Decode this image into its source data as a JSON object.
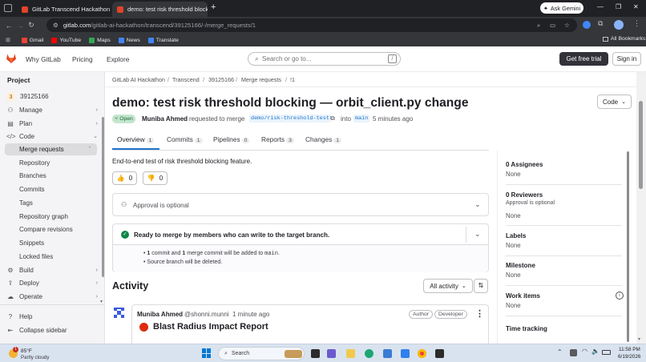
{
  "browser": {
    "tabs": [
      {
        "title": "GitLab Transcend Hackathon o"
      },
      {
        "title": "demo: test risk threshold blocki"
      }
    ],
    "ask_gemini": "Ask Gemini",
    "url_host": "gitlab.com",
    "url_path": "/gitlab-ai-hackathon/transcend/39125166/-/merge_requests/1",
    "bookmarks": [
      "Gmail",
      "YouTube",
      "Maps",
      "News",
      "Translate"
    ],
    "all_bookmarks": "All Bookmarks"
  },
  "header": {
    "nav": [
      "Why GitLab",
      "Pricing",
      "Explore"
    ],
    "search_placeholder": "Search or go to...",
    "search_shortcut": "/",
    "free_trial": "Get free trial",
    "sign_in": "Sign in"
  },
  "sidebar": {
    "heading": "Project",
    "project_avatar": "3",
    "project_name": "39125166",
    "items": [
      {
        "label": "Manage"
      },
      {
        "label": "Plan"
      },
      {
        "label": "Code"
      },
      {
        "label": "Merge requests"
      },
      {
        "label": "Repository"
      },
      {
        "label": "Branches"
      },
      {
        "label": "Commits"
      },
      {
        "label": "Tags"
      },
      {
        "label": "Repository graph"
      },
      {
        "label": "Compare revisions"
      },
      {
        "label": "Snippets"
      },
      {
        "label": "Locked files"
      },
      {
        "label": "Build"
      },
      {
        "label": "Deploy"
      },
      {
        "label": "Operate"
      }
    ],
    "help": "Help",
    "collapse": "Collapse sidebar"
  },
  "breadcrumb": [
    "GitLab AI Hackathon",
    "Transcend",
    "39125166",
    "Merge requests",
    "!1"
  ],
  "mr": {
    "title": "demo: test risk threshold blocking — orbit_client.py change",
    "code_button": "Code",
    "status": "Open",
    "author": "Muniba Ahmed",
    "requested_text": "requested to merge",
    "source_branch": "demo/risk-threshold-test",
    "into_text": "into",
    "target_branch": "main",
    "time": "5 minutes ago",
    "tabs": [
      {
        "label": "Overview",
        "count": "1"
      },
      {
        "label": "Commits",
        "count": "1"
      },
      {
        "label": "Pipelines",
        "count": "0"
      },
      {
        "label": "Reports",
        "count": "3"
      },
      {
        "label": "Changes",
        "count": "1"
      }
    ],
    "description": "End-to-end test of risk threshold blocking feature.",
    "thumbs_up": "0",
    "thumbs_down": "0",
    "approval": "Approval is optional",
    "ready_text": "Ready to merge by members who can write to the target branch.",
    "commit_num": "1",
    "commit_text": "commit and",
    "merge_num": "1",
    "merge_text": "merge commit will be added to",
    "merge_target": "main",
    "source_deleted": "Source branch will be deleted."
  },
  "activity": {
    "heading": "Activity",
    "filter": "All activity",
    "comment_author": "Muniba Ahmed",
    "comment_handle": "@shonni.munni",
    "comment_time": "1 minute ago",
    "badge_author": "Author",
    "badge_developer": "Developer",
    "comment_title": "Blast Radius Impact Report"
  },
  "rightbar": {
    "assignees_label": "0 Assignees",
    "assignees_value": "None",
    "reviewers_label": "0 Reviewers",
    "reviewers_sub": "Approval is optional",
    "reviewers_value": "None",
    "labels_label": "Labels",
    "labels_value": "None",
    "milestone_label": "Milestone",
    "milestone_value": "None",
    "work_items_label": "Work items",
    "work_items_value": "None",
    "time_tracking_label": "Time tracking"
  },
  "taskbar": {
    "weather_temp": "85°F",
    "weather_desc": "Partly cloudy",
    "weather_badge": "1",
    "search": "Search",
    "time": "11:58 PM",
    "date": "6/19/2026"
  },
  "colors": {
    "accent": "#1f75cb",
    "open_green": "#108548",
    "tab_underline": "#1f75cb",
    "gitlab_orange": "#e24329"
  }
}
